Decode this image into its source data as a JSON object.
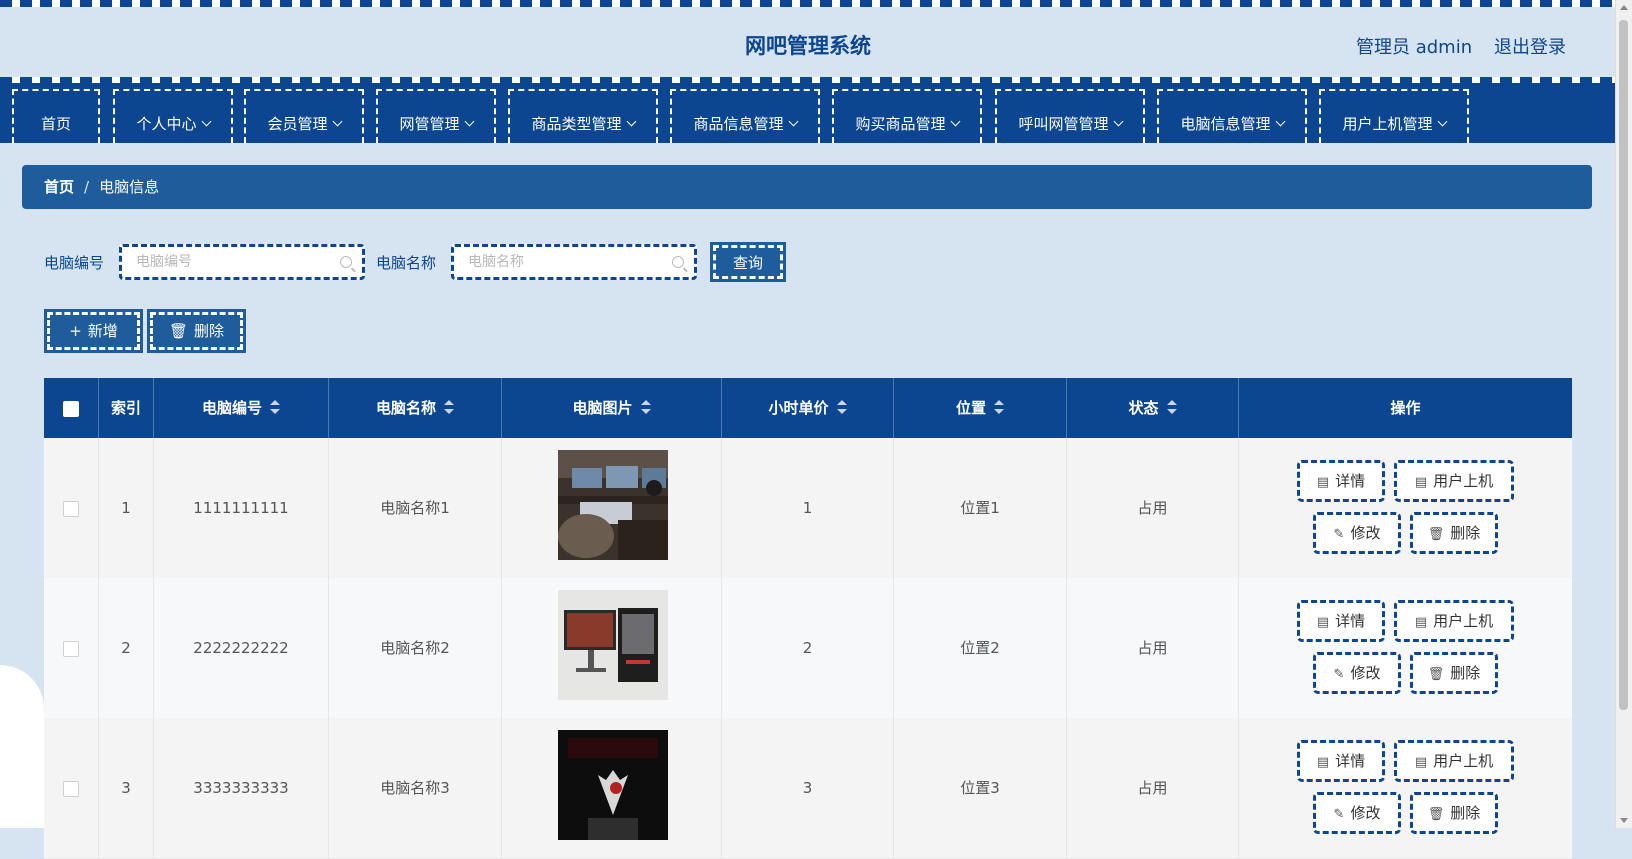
{
  "header": {
    "title": "网吧管理系统",
    "user_label": "管理员 admin",
    "logout_label": "退出登录"
  },
  "nav": {
    "items": [
      {
        "label": "首页",
        "has_dropdown": false
      },
      {
        "label": "个人中心",
        "has_dropdown": true
      },
      {
        "label": "会员管理",
        "has_dropdown": true
      },
      {
        "label": "网管管理",
        "has_dropdown": true
      },
      {
        "label": "商品类型管理",
        "has_dropdown": true
      },
      {
        "label": "商品信息管理",
        "has_dropdown": true
      },
      {
        "label": "购买商品管理",
        "has_dropdown": true
      },
      {
        "label": "呼叫网管管理",
        "has_dropdown": true
      },
      {
        "label": "电脑信息管理",
        "has_dropdown": true
      },
      {
        "label": "用户上机管理",
        "has_dropdown": true
      }
    ]
  },
  "breadcrumb": {
    "home": "首页",
    "separator": "/",
    "current": "电脑信息"
  },
  "search": {
    "code_label": "电脑编号",
    "code_placeholder": "电脑编号",
    "name_label": "电脑名称",
    "name_placeholder": "电脑名称",
    "query_button": "查询"
  },
  "toolbar": {
    "add_label": "新增",
    "delete_label": "删除"
  },
  "table": {
    "headers": {
      "index": "索引",
      "code": "电脑编号",
      "name": "电脑名称",
      "image": "电脑图片",
      "price": "小时单价",
      "location": "位置",
      "status": "状态",
      "actions": "操作"
    },
    "rows": [
      {
        "index": "1",
        "code": "1111111111",
        "name": "电脑名称1",
        "price": "1",
        "location": "位置1",
        "status": "占用"
      },
      {
        "index": "2",
        "code": "2222222222",
        "name": "电脑名称2",
        "price": "2",
        "location": "位置2",
        "status": "占用"
      },
      {
        "index": "3",
        "code": "3333333333",
        "name": "电脑名称3",
        "price": "3",
        "location": "位置3",
        "status": "占用"
      }
    ],
    "row_actions": {
      "detail": "详情",
      "user_login": "用户上机",
      "edit": "修改",
      "delete": "删除"
    }
  },
  "colors": {
    "primary": "#0c4590",
    "breadcrumb": "#1f5c9c",
    "page_bg": "#d6e4f1"
  }
}
